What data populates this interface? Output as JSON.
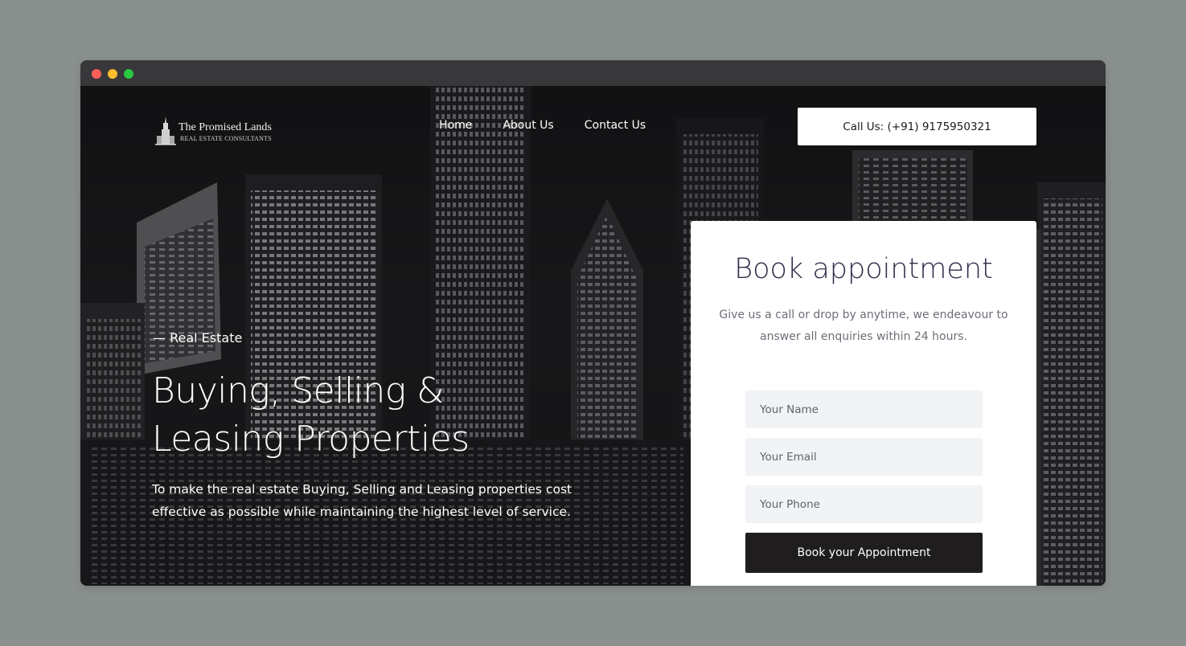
{
  "brand": {
    "name": "The Promised Lands",
    "tagline": "REAL ESTATE CONSULTANTS"
  },
  "nav": {
    "items": [
      "Home",
      "About Us",
      "Contact Us"
    ],
    "call_label": "Call Us: (+91) 9175950321"
  },
  "hero": {
    "eyebrow": "— Real Estate",
    "headline_line1": "Buying, Selling &",
    "headline_line2": "Leasing Properties",
    "description": "To make the real estate Buying, Selling and Leasing properties cost effective as possible while maintaining the highest level of service."
  },
  "form": {
    "title": "Book appointment",
    "subtitle": "Give us a call or drop by anytime, we endeavour to answer all enquiries within 24 hours.",
    "name_placeholder": "Your Name",
    "email_placeholder": "Your Email",
    "phone_placeholder": "Your Phone",
    "submit_label": "Book your Appointment"
  },
  "colors": {
    "page_bg": "#8a908d",
    "titlebar": "#38383b",
    "form_title": "#2f2d4b",
    "button_dark": "#1f1d1e",
    "field_bg": "#f2f3f5"
  }
}
